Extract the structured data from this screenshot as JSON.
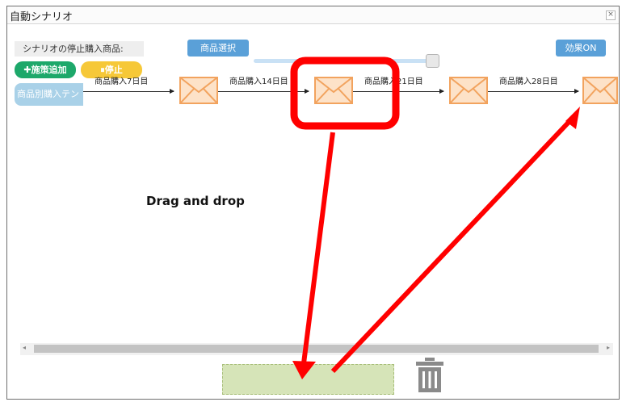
{
  "window": {
    "title": "自動シナリオ",
    "close_glyph": "×"
  },
  "toolbar": {
    "stop_label": "シナリオの停止購入商品:",
    "product_select_label": "商品選択",
    "effect_toggle_label": "効果ON",
    "add_measure_label": "✚施策追加",
    "stop_button_label": "⏸停止"
  },
  "flow": {
    "start_label": "商品別購入テン",
    "steps": [
      {
        "label": "商品購入7日目",
        "icon": "envelope-icon"
      },
      {
        "label": "商品購入14日目",
        "icon": "envelope-icon"
      },
      {
        "label": "商品購入21日目",
        "icon": "envelope-icon"
      },
      {
        "label": "商品購入28日目",
        "icon": "envelope-icon"
      }
    ]
  },
  "annotation": {
    "instruction": "Drag and drop",
    "highlight_color": "#ff0000"
  },
  "footer": {
    "drop_zone_color": "#d6e4b8",
    "trash_icon": "trash-icon"
  },
  "scrollbar": {
    "left_glyph": "◂",
    "right_glyph": "▸"
  }
}
